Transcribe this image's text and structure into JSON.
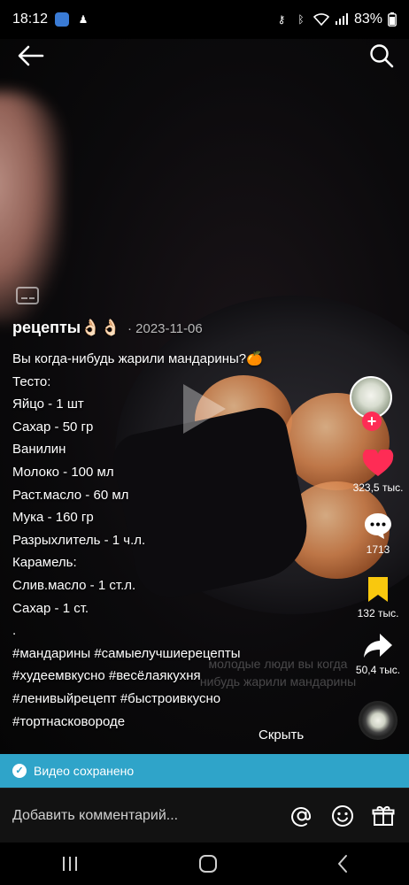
{
  "status": {
    "time": "18:12",
    "battery": "83%"
  },
  "post": {
    "author": "рецепты👌🏻👌🏻",
    "date": "· 2023-11-06",
    "caption_lines": [
      "Вы когда-нибудь жарили мандарины?🍊",
      "Тесто:",
      "Яйцо - 1 шт",
      "Сахар - 50 гр",
      "Ванилин",
      "Молоко - 100 мл",
      "Раст.масло - 60 мл",
      "Мука - 160 гр",
      "Разрыхлитель - 1 ч.л.",
      "Карамель:",
      "Слив.масло - 1 ст.л.",
      "Сахар - 1 ст.",
      ".",
      "#мандарины #самыелучшиерецепты",
      "#худеемвкусно #весёлаякухня",
      "#ленивыйрецепт #быстроивкусно",
      "#тортнасковороде"
    ],
    "video_overlay_text": "молодые люди вы когда нибудь жарили мандарины",
    "hide_label": "Скрыть"
  },
  "rail": {
    "follow_label": "+",
    "likes": "323,5 тыс.",
    "comments": "1713",
    "saves": "132 тыс.",
    "shares": "50,4 тыс."
  },
  "toast": {
    "text": "Видео сохранено"
  },
  "comment_bar": {
    "placeholder": "Добавить комментарий..."
  },
  "colors": {
    "like": "#fe2c55",
    "save": "#f9c80e",
    "toast": "#2fa4c9"
  },
  "icons": [
    "back-arrow-icon",
    "search-icon",
    "captions-icon",
    "play-icon",
    "heart-icon",
    "comment-icon",
    "bookmark-icon",
    "share-icon",
    "mention-icon",
    "emoji-icon",
    "gift-icon",
    "recent-apps-icon",
    "home-icon",
    "back-icon"
  ]
}
